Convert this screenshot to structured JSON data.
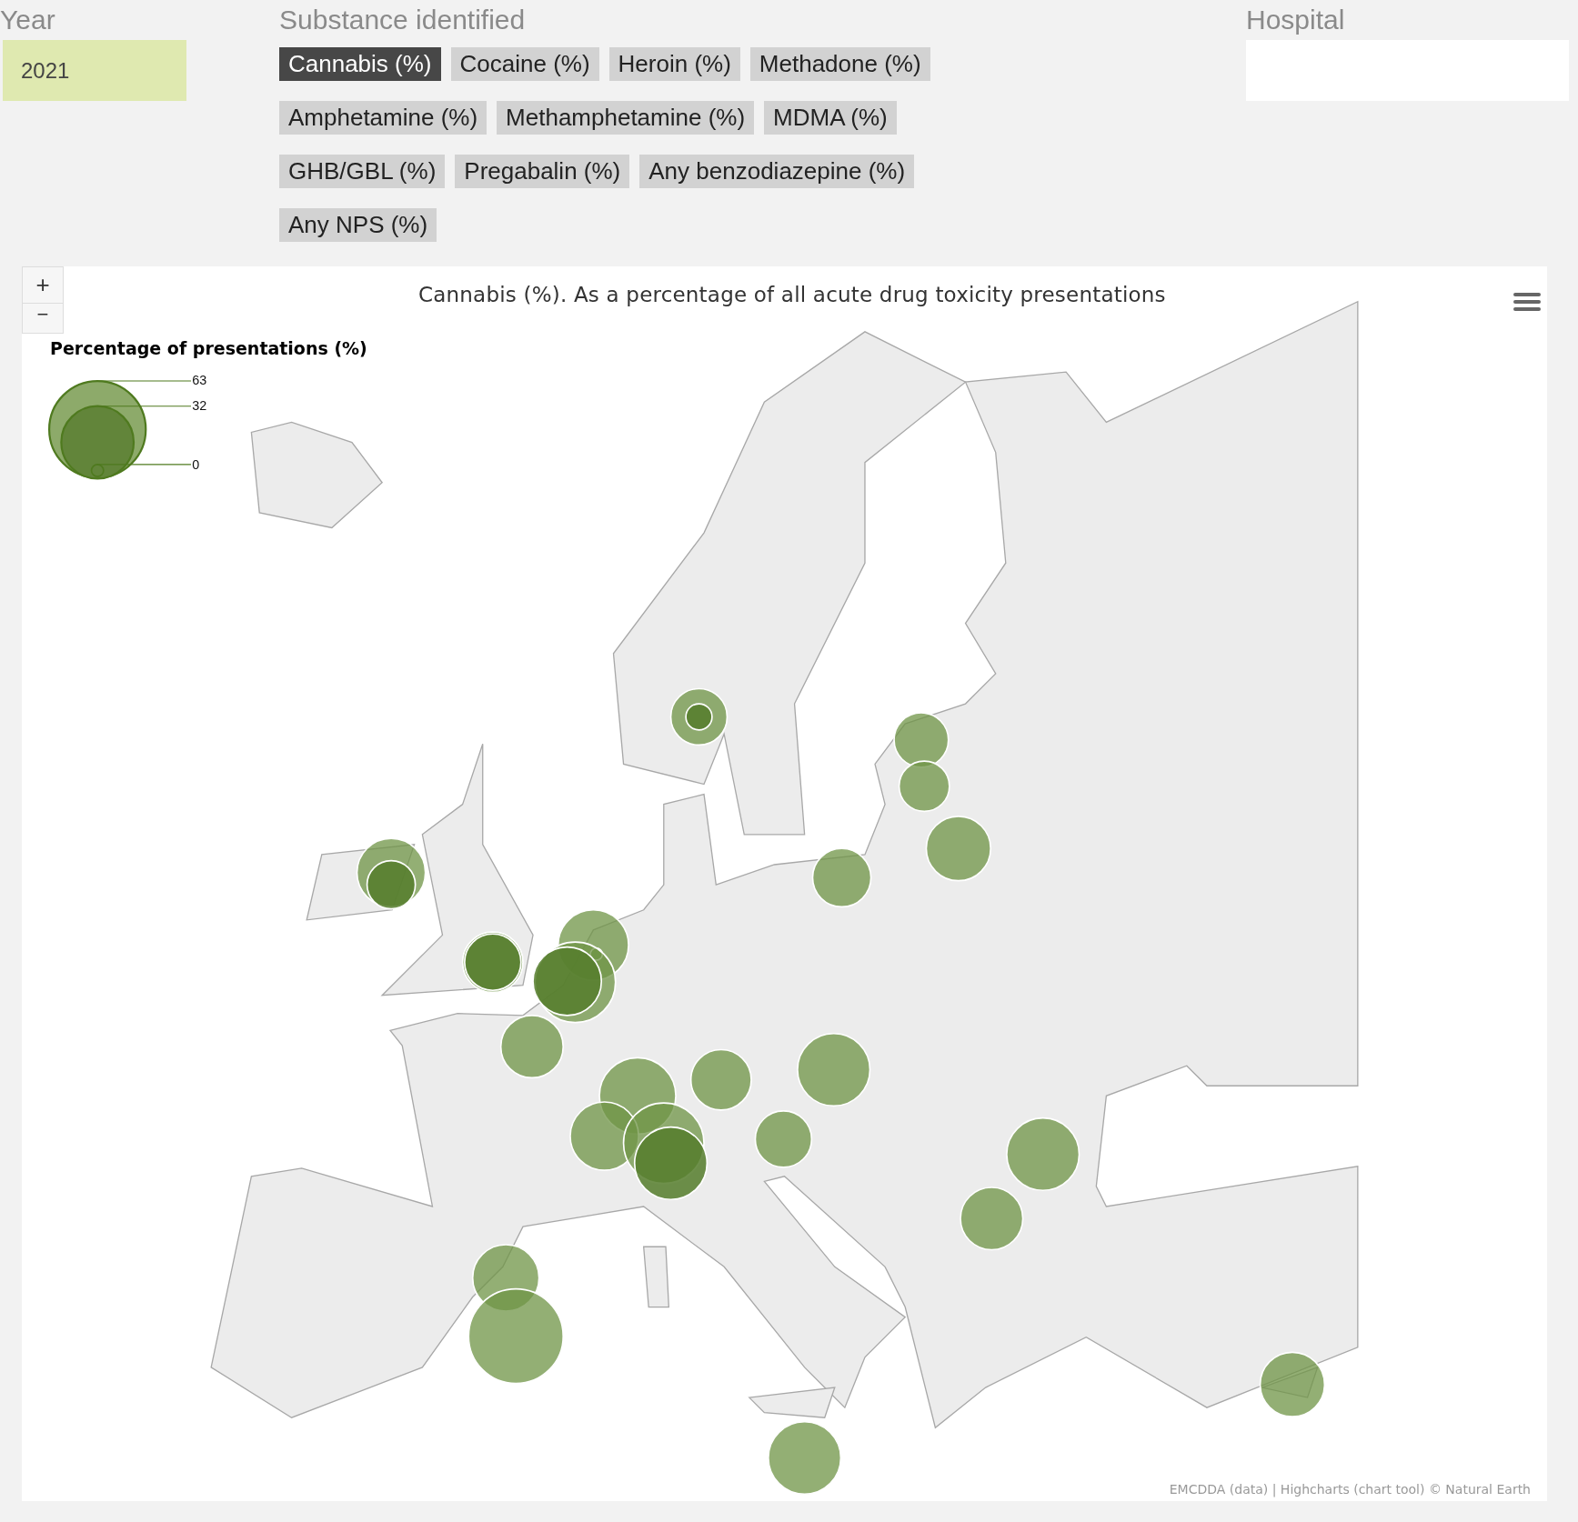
{
  "year": {
    "label": "Year",
    "value": "2021"
  },
  "substance": {
    "label": "Substance identified",
    "rows": [
      [
        {
          "label": "Cannabis (%)",
          "selected": true
        },
        {
          "label": "Cocaine (%)",
          "selected": false
        },
        {
          "label": "Heroin (%)",
          "selected": false
        },
        {
          "label": "Methadone (%)",
          "selected": false
        }
      ],
      [
        {
          "label": "Amphetamine (%)",
          "selected": false
        },
        {
          "label": "Methamphetamine (%)",
          "selected": false
        },
        {
          "label": "MDMA (%)",
          "selected": false
        }
      ],
      [
        {
          "label": "GHB/GBL (%)",
          "selected": false
        },
        {
          "label": "Pregabalin (%)",
          "selected": false
        },
        {
          "label": "Any benzodiazepine (%)",
          "selected": false
        }
      ],
      [
        {
          "label": "Any NPS (%)",
          "selected": false
        }
      ]
    ]
  },
  "hospital": {
    "label": "Hospital"
  },
  "map": {
    "zoom_in": "+",
    "zoom_out": "−",
    "title": "Cannabis (%). As a percentage of all acute drug toxicity presentations",
    "legend": {
      "title": "Percentage of presentations (%)",
      "values": [
        "63",
        "32",
        "0"
      ]
    },
    "credits": "EMCDDA (data) | Highcharts (chart tool) © Natural Earth"
  }
}
